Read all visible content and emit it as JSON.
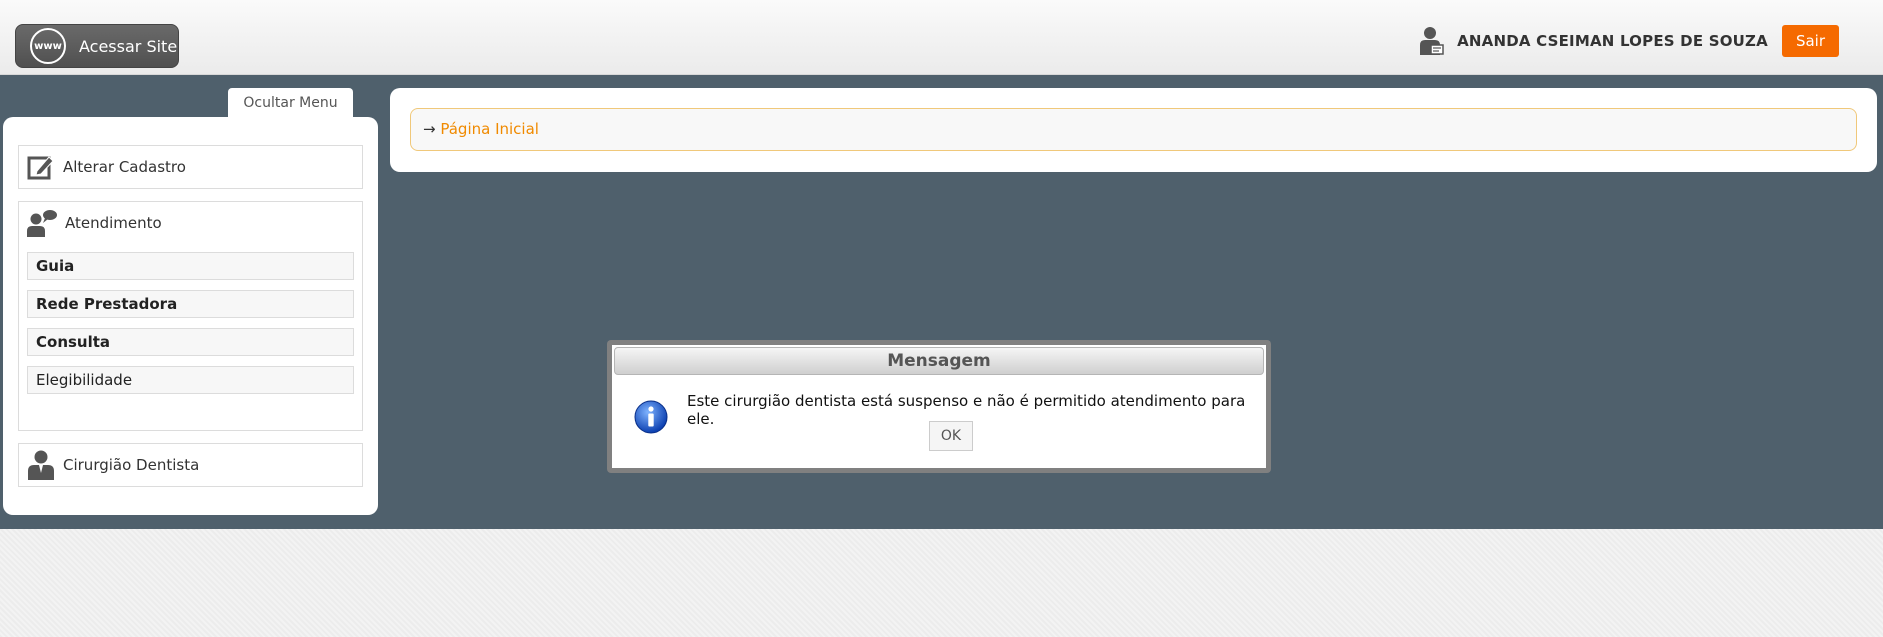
{
  "header": {
    "site_button_label": "Acessar Site",
    "www_icon_text": "www",
    "user_name": "ANANDA CSEIMAN LOPES DE SOUZA",
    "logout_label": "Sair"
  },
  "sidebar": {
    "hide_menu_label": "Ocultar Menu",
    "change_registration_label": "Alterar Cadastro",
    "service_group": {
      "label": "Atendimento",
      "items": [
        {
          "label": "Guia",
          "bold": true
        },
        {
          "label": "Rede Prestadora",
          "bold": true
        },
        {
          "label": "Consulta",
          "bold": true
        },
        {
          "label": "Elegibilidade",
          "bold": false
        }
      ]
    },
    "dentist_label": "Cirurgião Dentista"
  },
  "breadcrumb": {
    "arrow": "→",
    "home_label": "Página Inicial"
  },
  "dialog": {
    "title": "Mensagem",
    "message": "Este cirurgião dentista está suspenso e não é permitido atendimento para ele.",
    "ok_label": "OK"
  },
  "colors": {
    "accent_orange": "#f56a00",
    "link_orange": "#f08a00",
    "main_background": "#4f606c"
  }
}
